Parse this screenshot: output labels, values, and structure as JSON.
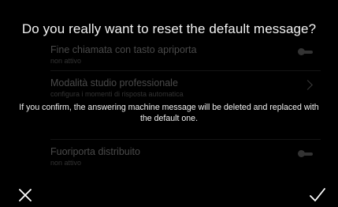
{
  "background_list": {
    "items": [
      {
        "title": "Fine chiamata con tasto apriporta",
        "subtitle": "non attivo",
        "control": "toggle"
      },
      {
        "title": "Modalità studio professionale",
        "subtitle": "configura i momenti di risposta automatica",
        "control": "chevron"
      },
      {
        "title": "Fuoriporta distribuito",
        "subtitle": "non attivo",
        "control": "toggle"
      }
    ]
  },
  "dialog": {
    "title": "Do you really want to reset the default message?",
    "message": "If you confirm, the answering machine message will be deleted and replaced with the default one.",
    "cancel_icon": "close-icon",
    "confirm_icon": "check-icon"
  },
  "colors": {
    "background": "#000000",
    "text": "#ffffff",
    "dimmed_text": "#4a4a4a"
  }
}
